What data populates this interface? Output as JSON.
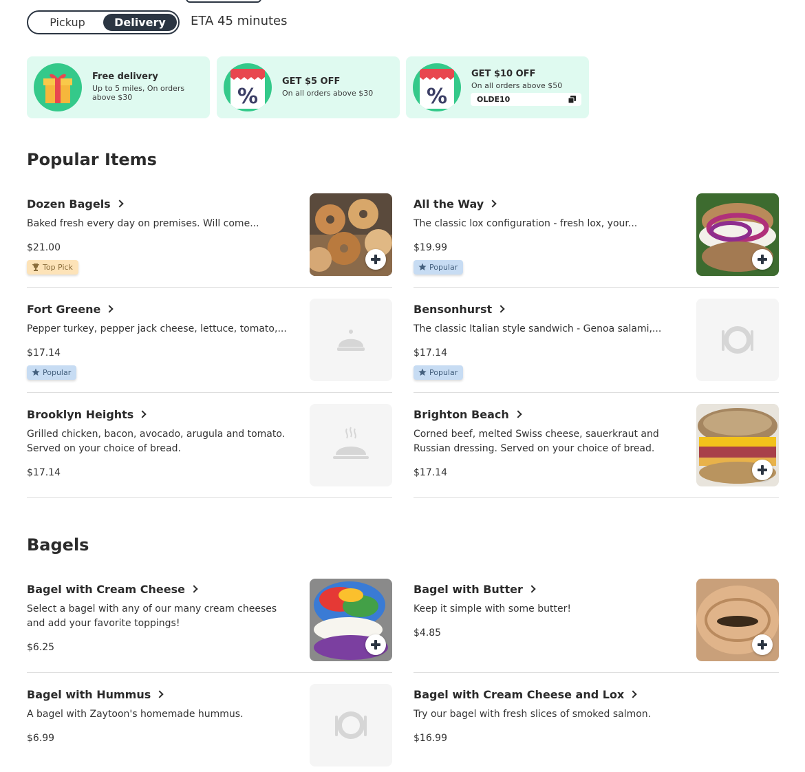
{
  "order_mode": {
    "pickup_label": "Pickup",
    "delivery_label": "Delivery",
    "selected": "Delivery",
    "eta": "ETA 45 minutes"
  },
  "offers": [
    {
      "title": "Free delivery",
      "subtitle_line1": "Up to 5 miles, On orders",
      "subtitle_line2": "above $30",
      "icon": "gift-icon"
    },
    {
      "title": "GET $5 OFF",
      "subtitle_line1": "On all orders above $30",
      "icon": "percent-discount-icon"
    },
    {
      "title": "GET $10 OFF",
      "subtitle_line1": "On all orders above $50",
      "coupon_code": "OLDE10",
      "icon": "percent-discount-icon"
    }
  ],
  "sections": [
    {
      "title": "Popular Items",
      "items": [
        {
          "name": "Dozen Bagels",
          "description": "Baked fresh every day on premises. Will come...",
          "price": "$21.00",
          "badge": "Top Pick",
          "image": "bagels-photo"
        },
        {
          "name": "All the Way",
          "description": "The classic lox configuration - fresh lox, your...",
          "price": "$19.99",
          "badge": "Popular",
          "image": "lox-bagel-photo"
        },
        {
          "name": "Fort Greene",
          "description": "Pepper turkey, pepper jack cheese, lettuce, tomato,...",
          "price": "$17.14",
          "badge": "Popular",
          "image": "cloche-placeholder-icon"
        },
        {
          "name": "Bensonhurst",
          "description": "The classic Italian style sandwich - Genoa salami,...",
          "price": "$17.14",
          "badge": "Popular",
          "image": "plate-placeholder-icon"
        },
        {
          "name": "Brooklyn Heights",
          "description": "Grilled chicken, bacon, avocado, arugula and tomato. Served on your choice of bread.",
          "price": "$17.14",
          "image": "steaming-dish-placeholder-icon"
        },
        {
          "name": "Brighton Beach",
          "description": "Corned beef, melted Swiss cheese, sauerkraut and Russian dressing. Served on your choice of bread.",
          "price": "$17.14",
          "image": "reuben-bagel-photo"
        }
      ]
    },
    {
      "title": "Bagels",
      "items": [
        {
          "name": "Bagel with Cream Cheese",
          "description": "Select a bagel with any of our many cream cheeses and add your favorite toppings!",
          "price": "$6.25",
          "image": "rainbow-bagel-photo"
        },
        {
          "name": "Bagel with Butter",
          "description": "Keep it simple with some butter!",
          "price": "$4.85",
          "image": "butter-bagel-photo"
        },
        {
          "name": "Bagel with Hummus",
          "description": "A bagel with Zaytoon's homemade hummus.",
          "price": "$6.99",
          "image": "plate-placeholder-icon"
        },
        {
          "name": "Bagel with Cream Cheese and Lox",
          "description": "Try our bagel with fresh slices of smoked salmon.",
          "price": "$16.99"
        }
      ]
    }
  ]
}
